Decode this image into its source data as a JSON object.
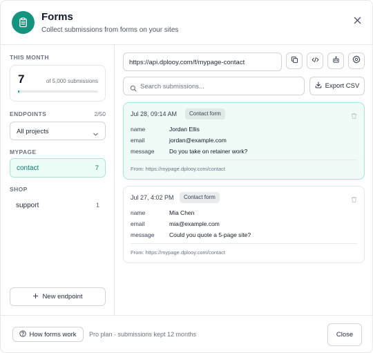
{
  "header": {
    "title": "Forms",
    "subtitle": "Collect submissions from forms on your sites",
    "icon": "clipboard-icon",
    "accent": "#14937e"
  },
  "sidebar": {
    "this_month_label": "THIS MONTH",
    "usage": {
      "count": "7",
      "of_label": "of 5,000 submissions",
      "fraction": 0.0014
    },
    "endpoints_label": "ENDPOINTS",
    "endpoints_count": "2/50",
    "project_select": {
      "value": "All projects"
    },
    "groups": [
      {
        "label": "MYPAGE",
        "items": [
          {
            "name": "contact",
            "count": "7",
            "active": true
          }
        ]
      },
      {
        "label": "SHOP",
        "items": [
          {
            "name": "support",
            "count": "1",
            "active": false
          }
        ]
      }
    ],
    "new_endpoint_label": "New endpoint"
  },
  "main": {
    "endpoint_url": "https://api.dplooy.com/f/mypage-contact",
    "toolbar_icons": [
      "copy-icon",
      "code-icon",
      "bot-icon",
      "settings-icon"
    ],
    "search_placeholder": "Search submissions...",
    "export_label": "Export CSV",
    "submissions": [
      {
        "date": "Jul 28, 09:14 AM",
        "tag": "Contact form",
        "fields": [
          {
            "key": "name",
            "value": "Jordan Ellis"
          },
          {
            "key": "email",
            "value": "jordan@example.com"
          },
          {
            "key": "message",
            "value": "Do you take on retainer work?"
          }
        ],
        "from": "From: https://mypage.dplooy.com/contact",
        "highlight": true
      },
      {
        "date": "Jul 27, 4:02 PM",
        "tag": "Contact form",
        "fields": [
          {
            "key": "name",
            "value": "Mia Chen"
          },
          {
            "key": "email",
            "value": "mia@example.com"
          },
          {
            "key": "message",
            "value": "Could you quote a 5-page site?"
          }
        ],
        "from": "From: https://mypage.dplooy.com/contact",
        "highlight": false
      }
    ]
  },
  "footer": {
    "help_label": "How forms work",
    "plan_text": "Pro plan · submissions kept 12 months",
    "close_label": "Close"
  }
}
